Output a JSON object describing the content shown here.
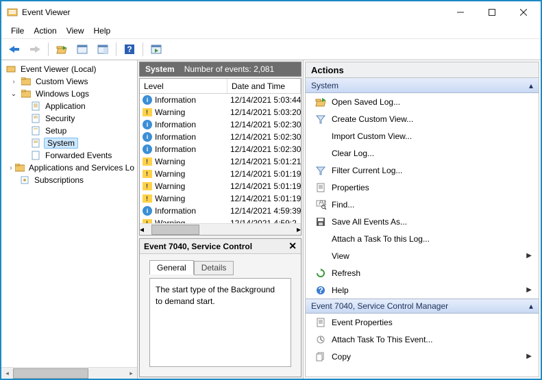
{
  "titlebar": {
    "title": "Event Viewer"
  },
  "menubar": [
    "File",
    "Action",
    "View",
    "Help"
  ],
  "tree": {
    "root": "Event Viewer (Local)",
    "items": [
      {
        "label": "Custom Views",
        "expander": "›"
      },
      {
        "label": "Windows Logs",
        "expander": "⌄",
        "children": [
          {
            "label": "Application"
          },
          {
            "label": "Security"
          },
          {
            "label": "Setup"
          },
          {
            "label": "System",
            "selected": true
          },
          {
            "label": "Forwarded Events"
          }
        ]
      },
      {
        "label": "Applications and Services Lo",
        "expander": "›"
      },
      {
        "label": "Subscriptions"
      }
    ]
  },
  "mid": {
    "header_name": "System",
    "header_count": "Number of events: 2,081",
    "columns": {
      "level": "Level",
      "date": "Date and Time"
    },
    "rows": [
      {
        "icon": "info",
        "level": "Information",
        "dt": "12/14/2021 5:03:44"
      },
      {
        "icon": "warn",
        "level": "Warning",
        "dt": "12/14/2021 5:03:20"
      },
      {
        "icon": "info",
        "level": "Information",
        "dt": "12/14/2021 5:02:30"
      },
      {
        "icon": "info",
        "level": "Information",
        "dt": "12/14/2021 5:02:30"
      },
      {
        "icon": "info",
        "level": "Information",
        "dt": "12/14/2021 5:02:30"
      },
      {
        "icon": "warn",
        "level": "Warning",
        "dt": "12/14/2021 5:01:21"
      },
      {
        "icon": "warn",
        "level": "Warning",
        "dt": "12/14/2021 5:01:19"
      },
      {
        "icon": "warn",
        "level": "Warning",
        "dt": "12/14/2021 5:01:19"
      },
      {
        "icon": "warn",
        "level": "Warning",
        "dt": "12/14/2021 5:01:19"
      },
      {
        "icon": "info",
        "level": "Information",
        "dt": "12/14/2021 4:59:39"
      },
      {
        "icon": "warn",
        "level": "Warning",
        "dt": "12/14/2021 4:59:2"
      }
    ],
    "detail_title": "Event 7040, Service Control",
    "tabs": {
      "general": "General",
      "details": "Details"
    },
    "detail_text": "The start type of the Background\nto demand start."
  },
  "actions": {
    "title": "Actions",
    "section1": "System",
    "items1": [
      {
        "icon": "open",
        "label": "Open Saved Log..."
      },
      {
        "icon": "filter",
        "label": "Create Custom View..."
      },
      {
        "icon": "",
        "label": "Import Custom View...",
        "indent": true
      },
      {
        "icon": "",
        "label": "Clear Log...",
        "indent": true
      },
      {
        "icon": "funnel",
        "label": "Filter Current Log..."
      },
      {
        "icon": "props",
        "label": "Properties"
      },
      {
        "icon": "find",
        "label": "Find..."
      },
      {
        "icon": "save",
        "label": "Save All Events As..."
      },
      {
        "icon": "",
        "label": "Attach a Task To this Log...",
        "indent": true
      },
      {
        "icon": "",
        "label": "View",
        "indent": true,
        "arrow": true
      },
      {
        "icon": "refresh",
        "label": "Refresh"
      },
      {
        "icon": "help",
        "label": "Help",
        "arrow": true
      }
    ],
    "section2": "Event 7040, Service Control Manager",
    "items2": [
      {
        "icon": "props",
        "label": "Event Properties"
      },
      {
        "icon": "attach",
        "label": "Attach Task To This Event..."
      },
      {
        "icon": "copy",
        "label": "Copy",
        "arrow": true
      }
    ]
  }
}
